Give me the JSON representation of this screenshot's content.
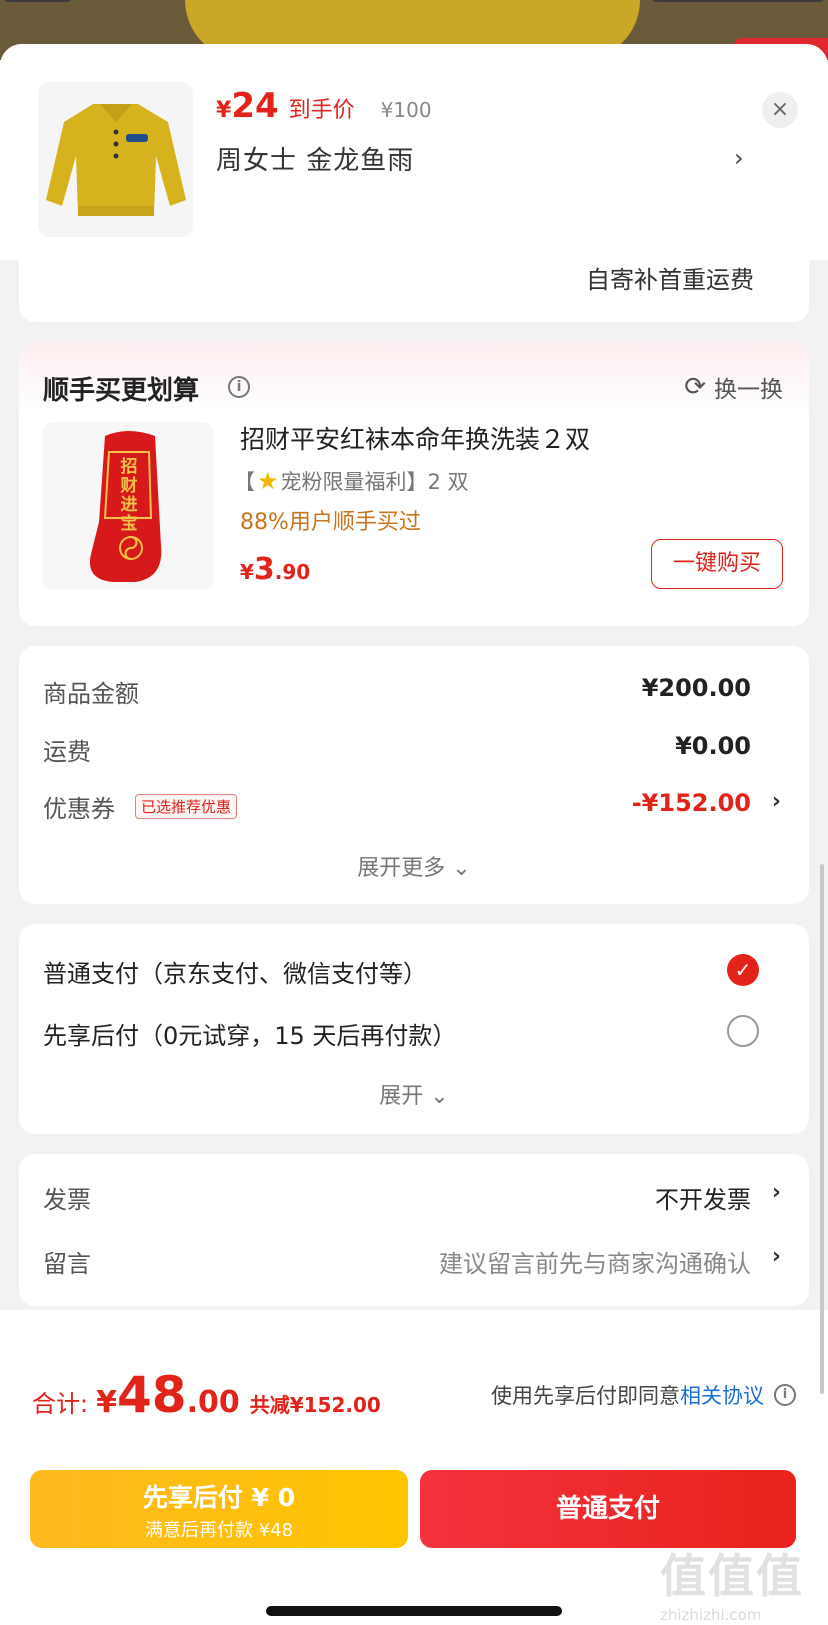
{
  "header": {
    "price_symbol": "¥",
    "price_value": "24",
    "price_tag": "到手价",
    "original_price": "¥100",
    "product_name": "周女士  金龙鱼雨",
    "chevron": "›",
    "close": "×"
  },
  "shipping": {
    "text": "自寄补首重运费"
  },
  "upsell": {
    "title": "顺手买更划算",
    "info": "i",
    "swap_label": "换一换",
    "name": "招财平安红袜本命年换洗装２双",
    "sub_prefix": "【",
    "sub_text": "宠粉限量福利】2 双",
    "percent_text": "88%用户顺手买过",
    "price_symbol": "¥",
    "price_int": "3",
    "price_dec": ".90",
    "buy_label": "一键购买",
    "sock_text": "招财进宝"
  },
  "amounts": {
    "goods_label": "商品金额",
    "goods_value": "¥200.00",
    "freight_label": "运费",
    "freight_value": "¥0.00",
    "coupon_label": "优惠券",
    "coupon_badge": "已选推荐优惠",
    "coupon_value": "-¥152.00",
    "expand_label": "展开更多 ⌄"
  },
  "payment": {
    "option1": "普通支付（京东支付、微信支付等）",
    "option2": "先享后付（0元试穿，15 天后再付款）",
    "selected": "option1",
    "expand_label": "展开 ⌄"
  },
  "invoice": {
    "label": "发票",
    "value": "不开发票",
    "note_label": "留言",
    "note_placeholder": "建议留言前先与商家沟通确认"
  },
  "footer": {
    "total_label": "合计:",
    "total_symbol": "¥",
    "total_int": "48",
    "total_dec": ".00",
    "discount": "共减¥152.00",
    "agree_prefix": "使用先享后付即同意",
    "agree_link": "相关协议",
    "btn_later_line1": "先享后付 ¥ 0",
    "btn_later_line2": "满意后再付款 ¥48",
    "btn_pay": "普通支付",
    "watermark": "值值值",
    "watermark_url": "zhizhizhi.com"
  },
  "colors": {
    "accent_red": "#e2231a",
    "link_blue": "#1a6fd3",
    "pay_later_yellow": "#ffc400",
    "percent_orange": "#c9741c"
  }
}
